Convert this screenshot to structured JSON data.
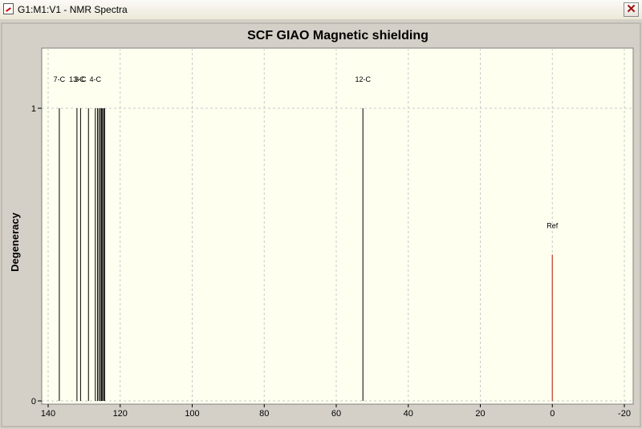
{
  "window": {
    "title": "G1:M1:V1 - NMR Spectra",
    "close_glyph": "✕",
    "icon": "nmr-document-icon"
  },
  "colors": {
    "plot_bg": "#fffff0",
    "ref": "#c0392b",
    "peaks": "#000000",
    "grid": "#c8c8c8"
  },
  "chart_data": {
    "type": "bar",
    "title": "SCF GIAO Magnetic shielding",
    "xlabel": "",
    "ylabel": "Degeneracy",
    "xlim": [
      140,
      -20
    ],
    "ylim": [
      0,
      1.2
    ],
    "grid": true,
    "x_ticks": [
      140,
      120,
      100,
      80,
      60,
      40,
      20,
      0,
      -20
    ],
    "y_ticks": [
      0,
      1
    ],
    "series": [
      {
        "peaks": [
          {
            "x": 136.9,
            "y": 1,
            "label": "7-C"
          },
          {
            "x": 132.0,
            "y": 1,
            "label": "13-C"
          },
          {
            "x": 131.0,
            "y": 1,
            "label": "3-C"
          },
          {
            "x": 128.8,
            "y": 1,
            "label": ""
          },
          {
            "x": 126.9,
            "y": 1,
            "label": "4-C"
          },
          {
            "x": 126.3,
            "y": 1,
            "label": ""
          },
          {
            "x": 125.9,
            "y": 1,
            "label": ""
          },
          {
            "x": 125.5,
            "y": 1,
            "label": ""
          },
          {
            "x": 125.2,
            "y": 1,
            "label": ""
          },
          {
            "x": 124.9,
            "y": 1,
            "label": ""
          },
          {
            "x": 124.6,
            "y": 1,
            "label": ""
          },
          {
            "x": 124.3,
            "y": 1,
            "label": ""
          },
          {
            "x": 52.6,
            "y": 1,
            "label": "12-C"
          }
        ]
      },
      {
        "name": "Ref",
        "peaks": [
          {
            "x": 0,
            "y": 0.5,
            "label": "Ref"
          }
        ]
      }
    ]
  }
}
